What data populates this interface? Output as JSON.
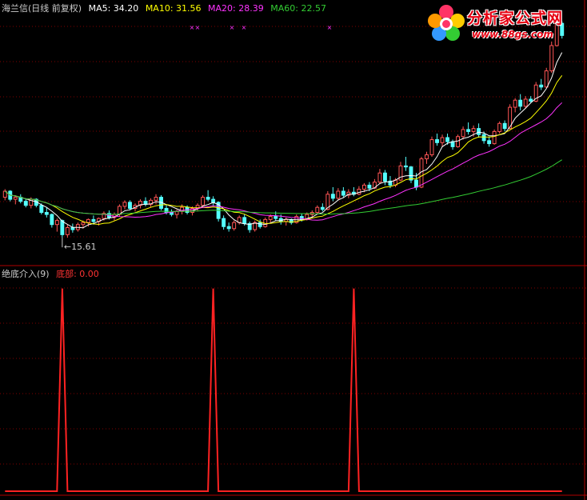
{
  "top_panel": {
    "title": "海兰信(日线 前复权)",
    "ma_labels": [
      {
        "key": "ma5",
        "text": "MA5: 34.20",
        "color": "#ffffff"
      },
      {
        "key": "ma10",
        "text": "MA10: 31.56",
        "color": "#ffff00"
      },
      {
        "key": "ma20",
        "text": "MA20: 28.39",
        "color": "#ff33ff"
      },
      {
        "key": "ma60",
        "text": "MA60: 22.57",
        "color": "#33cc33"
      }
    ],
    "low_marker": "15.61",
    "title_color": "#cccccc"
  },
  "bottom_panel": {
    "title": "绝底介入(9)",
    "indicator_label": "底部: 0.00",
    "title_color": "#cccccc",
    "indicator_color": "#ff3333"
  },
  "watermark": {
    "name": "分析家公式网",
    "url": "www.88gs.com"
  },
  "colors": {
    "background": "#000000",
    "grid": "#800000",
    "up_candle": "#ff5555",
    "down_candle": "#55ffff",
    "signal_line": "#ff2222"
  },
  "chart_data": [
    {
      "type": "candlestick",
      "title": "海兰信(日线 前复权)",
      "price_range": [
        13,
        38
      ],
      "low_annotation": 15.61,
      "candles": [
        [
          19.6,
          20.4,
          19.3,
          20.2
        ],
        [
          20.2,
          20.3,
          19.2,
          19.4
        ],
        [
          19.4,
          19.8,
          18.9,
          19.6
        ],
        [
          19.6,
          19.9,
          19.0,
          19.2
        ],
        [
          19.2,
          19.5,
          18.6,
          18.8
        ],
        [
          18.8,
          19.6,
          18.5,
          19.4
        ],
        [
          19.4,
          19.5,
          18.6,
          18.8
        ],
        [
          18.8,
          19.0,
          17.9,
          18.1
        ],
        [
          18.1,
          18.6,
          17.6,
          17.9
        ],
        [
          17.9,
          18.0,
          16.6,
          16.9
        ],
        [
          16.9,
          17.5,
          16.2,
          17.3
        ],
        [
          17.3,
          17.4,
          15.6,
          15.9
        ],
        [
          15.9,
          16.9,
          15.6,
          16.6
        ],
        [
          16.6,
          17.0,
          16.1,
          16.4
        ],
        [
          16.4,
          17.1,
          16.2,
          16.9
        ],
        [
          16.9,
          17.3,
          16.5,
          17.1
        ],
        [
          17.1,
          17.5,
          16.7,
          17.4
        ],
        [
          17.4,
          17.8,
          16.9,
          17.2
        ],
        [
          17.2,
          17.6,
          16.8,
          17.5
        ],
        [
          17.5,
          18.2,
          17.3,
          18.0
        ],
        [
          18.0,
          18.3,
          17.4,
          17.6
        ],
        [
          17.6,
          18.1,
          17.3,
          17.9
        ],
        [
          17.9,
          18.9,
          17.7,
          18.7
        ],
        [
          18.7,
          19.3,
          18.4,
          19.1
        ],
        [
          19.1,
          19.3,
          18.3,
          18.5
        ],
        [
          18.5,
          19.0,
          18.2,
          18.8
        ],
        [
          18.8,
          19.4,
          18.5,
          19.2
        ],
        [
          19.2,
          19.6,
          18.7,
          18.9
        ],
        [
          18.9,
          19.5,
          18.6,
          19.3
        ],
        [
          19.3,
          19.9,
          18.9,
          19.6
        ],
        [
          19.6,
          19.8,
          18.3,
          18.5
        ],
        [
          18.5,
          18.9,
          17.9,
          18.1
        ],
        [
          18.1,
          18.4,
          17.7,
          17.9
        ],
        [
          17.9,
          18.4,
          17.5,
          18.2
        ],
        [
          18.2,
          18.9,
          17.9,
          18.6
        ],
        [
          18.6,
          18.8,
          17.9,
          18.1
        ],
        [
          18.1,
          18.7,
          17.8,
          18.5
        ],
        [
          18.5,
          19.0,
          18.2,
          18.8
        ],
        [
          18.8,
          19.8,
          18.6,
          19.6
        ],
        [
          19.6,
          20.3,
          19.2,
          19.4
        ],
        [
          19.4,
          19.7,
          18.8,
          19.1
        ],
        [
          19.1,
          19.2,
          17.2,
          17.5
        ],
        [
          17.5,
          17.8,
          16.4,
          16.7
        ],
        [
          16.7,
          17.1,
          16.2,
          16.5
        ],
        [
          16.5,
          17.3,
          16.3,
          17.1
        ],
        [
          17.1,
          17.8,
          16.9,
          17.6
        ],
        [
          17.6,
          17.9,
          16.8,
          17.0
        ],
        [
          17.0,
          17.2,
          16.1,
          16.4
        ],
        [
          16.4,
          17.3,
          16.2,
          17.1
        ],
        [
          17.1,
          17.4,
          16.5,
          16.7
        ],
        [
          16.7,
          17.6,
          16.6,
          17.4
        ],
        [
          17.4,
          17.9,
          17.1,
          17.7
        ],
        [
          17.7,
          18.2,
          17.3,
          17.5
        ],
        [
          17.5,
          17.9,
          16.9,
          17.2
        ],
        [
          17.2,
          17.6,
          16.8,
          17.4
        ],
        [
          17.4,
          17.5,
          16.9,
          17.1
        ],
        [
          17.1,
          17.9,
          17.0,
          17.7
        ],
        [
          17.7,
          18.0,
          17.2,
          17.4
        ],
        [
          17.4,
          18.1,
          17.3,
          17.9
        ],
        [
          17.9,
          18.3,
          17.6,
          18.1
        ],
        [
          18.1,
          18.8,
          17.9,
          18.6
        ],
        [
          18.6,
          19.0,
          18.2,
          18.4
        ],
        [
          18.4,
          20.2,
          18.3,
          19.9
        ],
        [
          19.9,
          20.6,
          19.2,
          19.5
        ],
        [
          19.5,
          20.5,
          19.3,
          20.2
        ],
        [
          20.2,
          20.6,
          19.6,
          19.8
        ],
        [
          19.8,
          20.4,
          19.5,
          20.1
        ],
        [
          20.1,
          20.6,
          19.7,
          19.9
        ],
        [
          19.9,
          20.7,
          19.8,
          20.4
        ],
        [
          20.4,
          21.0,
          20.1,
          20.8
        ],
        [
          20.8,
          21.1,
          20.2,
          20.5
        ],
        [
          20.5,
          21.4,
          20.4,
          21.1
        ],
        [
          21.1,
          22.4,
          20.9,
          22.0
        ],
        [
          22.0,
          22.3,
          20.8,
          21.2
        ],
        [
          21.2,
          21.7,
          20.5,
          20.8
        ],
        [
          20.8,
          21.5,
          20.6,
          21.3
        ],
        [
          21.3,
          23.1,
          21.2,
          22.7
        ],
        [
          22.7,
          23.6,
          22.2,
          22.6
        ],
        [
          22.6,
          22.7,
          21.0,
          21.3
        ],
        [
          21.3,
          22.0,
          20.3,
          20.6
        ],
        [
          20.6,
          23.6,
          20.5,
          23.4
        ],
        [
          23.4,
          24.1,
          22.9,
          23.8
        ],
        [
          23.8,
          25.6,
          23.6,
          25.3
        ],
        [
          25.3,
          25.9,
          24.7,
          25.0
        ],
        [
          25.0,
          25.8,
          24.6,
          25.5
        ],
        [
          25.5,
          25.9,
          24.8,
          25.1
        ],
        [
          25.1,
          25.3,
          24.3,
          24.6
        ],
        [
          24.6,
          25.8,
          24.5,
          25.6
        ],
        [
          25.6,
          26.6,
          25.3,
          26.3
        ],
        [
          26.3,
          27.0,
          25.8,
          26.1
        ],
        [
          26.1,
          26.7,
          25.6,
          26.4
        ],
        [
          26.4,
          26.9,
          25.5,
          25.8
        ],
        [
          25.8,
          26.1,
          24.9,
          25.2
        ],
        [
          25.2,
          25.6,
          24.6,
          24.9
        ],
        [
          24.9,
          26.3,
          24.8,
          26.1
        ],
        [
          26.1,
          27.1,
          25.9,
          26.9
        ],
        [
          26.9,
          27.2,
          26.1,
          26.4
        ],
        [
          26.4,
          28.8,
          26.3,
          28.5
        ],
        [
          28.5,
          29.4,
          28.0,
          29.2
        ],
        [
          29.2,
          29.8,
          28.2,
          28.6
        ],
        [
          28.6,
          29.6,
          28.4,
          29.3
        ],
        [
          29.3,
          29.6,
          28.9,
          29.1
        ],
        [
          29.1,
          31.0,
          29.0,
          30.7
        ],
        [
          30.7,
          31.3,
          30.2,
          30.5
        ],
        [
          30.5,
          32.4,
          30.4,
          32.1
        ],
        [
          32.1,
          35.0,
          31.9,
          34.6
        ],
        [
          34.6,
          37.1,
          34.5,
          36.8
        ],
        [
          36.8,
          37.0,
          35.3,
          35.6
        ]
      ]
    },
    {
      "type": "line",
      "title": "绝底介入(9)",
      "series": [
        {
          "name": "底部",
          "peak_indices": [
            11,
            40,
            67
          ],
          "peak_value": 1,
          "base_value": 0
        }
      ],
      "ylim": [
        0,
        1.05
      ]
    }
  ]
}
